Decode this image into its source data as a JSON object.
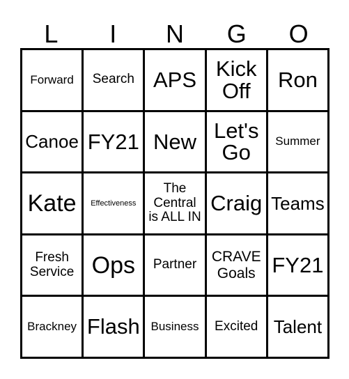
{
  "card": {
    "title": "LINGO bingo card",
    "header_letters": [
      "L",
      "I",
      "N",
      "G",
      "O"
    ],
    "colors": {
      "grid_line": "#000000",
      "background": "#ffffff",
      "text": "#000000"
    },
    "grid": {
      "columns": 5,
      "rows": 5,
      "cells": [
        [
          {
            "text": "Forward",
            "size": "sm"
          },
          {
            "text": "Search",
            "size": "md"
          },
          {
            "text": "APS",
            "size": "2xl"
          },
          {
            "text": "Kick\nOff",
            "size": "2xl"
          },
          {
            "text": "Ron",
            "size": "2xl"
          }
        ],
        [
          {
            "text": "Canoe",
            "size": "xl"
          },
          {
            "text": "FY21",
            "size": "2xl"
          },
          {
            "text": "New",
            "size": "2xl"
          },
          {
            "text": "Let's\nGo",
            "size": "2xl"
          },
          {
            "text": "Summer",
            "size": "sm"
          }
        ],
        [
          {
            "text": "Kate",
            "size": "3xl"
          },
          {
            "text": "Effectiveness",
            "size": "xs"
          },
          {
            "text": "The\nCentral\nis ALL IN",
            "size": "md"
          },
          {
            "text": "Craig",
            "size": "2xl"
          },
          {
            "text": "Teams",
            "size": "xl"
          }
        ],
        [
          {
            "text": "Fresh\nService",
            "size": "md"
          },
          {
            "text": "Ops",
            "size": "3xl"
          },
          {
            "text": "Partner",
            "size": "md"
          },
          {
            "text": "CRAVE\nGoals",
            "size": "lg"
          },
          {
            "text": "FY21",
            "size": "2xl"
          }
        ],
        [
          {
            "text": "Brackney",
            "size": "sm"
          },
          {
            "text": "Flash",
            "size": "2xl"
          },
          {
            "text": "Business",
            "size": "sm"
          },
          {
            "text": "Excited",
            "size": "md"
          },
          {
            "text": "Talent",
            "size": "xl"
          }
        ]
      ]
    }
  }
}
